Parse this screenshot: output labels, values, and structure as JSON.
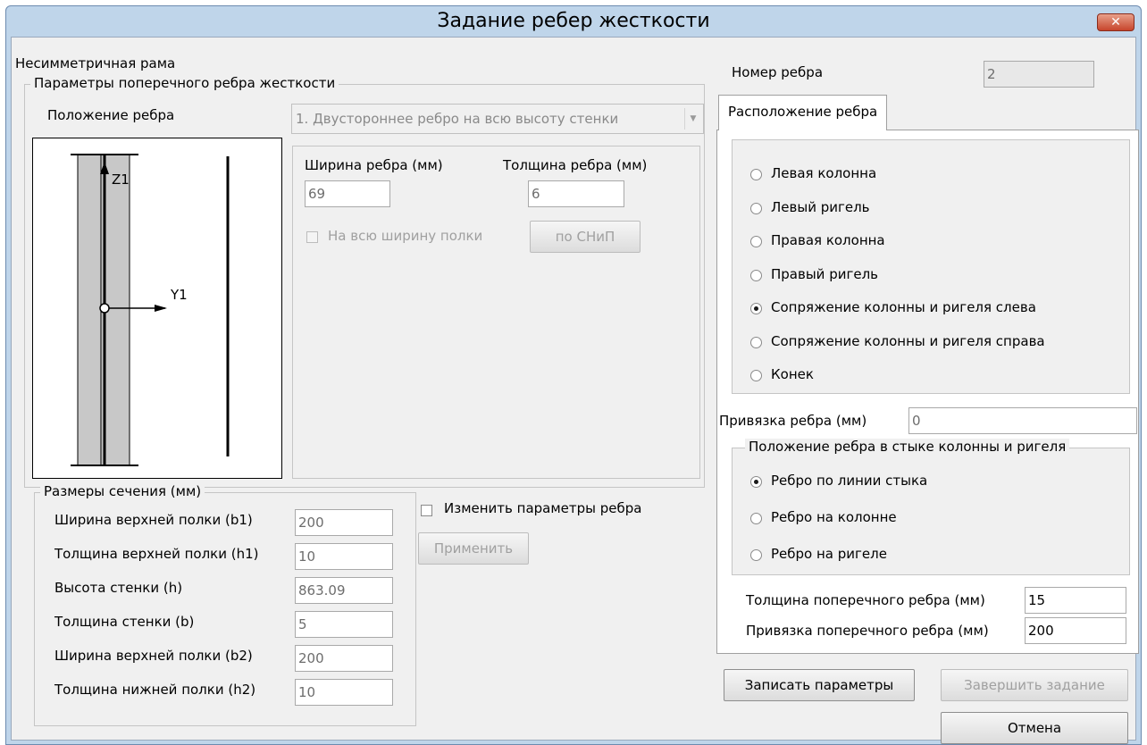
{
  "window": {
    "title": "Задание ребер жесткости",
    "close_label": "✕"
  },
  "frame_label": "Несимметричная рама",
  "rib_params": {
    "legend": "Параметры поперечного ребра жесткости",
    "position_label": "Положение ребра",
    "position_value": "1. Двустороннее ребро на всю высоту стенки",
    "width_label": "Ширина ребра (мм)",
    "width_value": "69",
    "thickness_label": "Толщина ребра (мм)",
    "thickness_value": "6",
    "full_width_label": "На всю ширину полки",
    "snip_button": "по СНиП"
  },
  "diagram": {
    "z_label": "Z1",
    "y_label": "Y1"
  },
  "section": {
    "legend": "Размеры сечения (мм)",
    "rows": [
      {
        "label": "Ширина верхней полки (b1)",
        "value": "200"
      },
      {
        "label": "Толщина верхней полки (h1)",
        "value": "10"
      },
      {
        "label": "Высота стенки (h)",
        "value": "863.09"
      },
      {
        "label": "Толщина стенки (b)",
        "value": "5"
      },
      {
        "label": "Ширина верхней полки (b2)",
        "value": "200"
      },
      {
        "label": "Толщина нижней полки (h2)",
        "value": "10"
      }
    ]
  },
  "change_params_label": "Изменить параметры ребра",
  "apply_button": "Применить",
  "rib_number": {
    "label": "Номер ребра",
    "value": "2"
  },
  "tab_label": "Расположение ребра",
  "location_options": [
    {
      "label": "Левая колонна",
      "selected": false
    },
    {
      "label": "Левый ригель",
      "selected": false
    },
    {
      "label": "Правая колонна",
      "selected": false
    },
    {
      "label": "Правый ригель",
      "selected": false
    },
    {
      "label": "Сопряжение колонны и ригеля слева",
      "selected": true
    },
    {
      "label": "Сопряжение колонны и ригеля справа",
      "selected": false
    },
    {
      "label": "Конек",
      "selected": false
    }
  ],
  "binding": {
    "label": "Привязка ребра (мм)",
    "value": "0"
  },
  "joint": {
    "legend": "Положение ребра в стыке колонны и ригеля",
    "options": [
      {
        "label": "Ребро по линии стыка",
        "selected": true
      },
      {
        "label": "Ребро на колонне",
        "selected": false
      },
      {
        "label": "Ребро на ригеле",
        "selected": false
      }
    ]
  },
  "cross_rib": {
    "thickness_label": "Толщина поперечного ребра (мм)",
    "thickness_value": "15",
    "binding_label": "Привязка поперечного ребра (мм)",
    "binding_value": "200"
  },
  "buttons": {
    "save": "Записать параметры",
    "finish": "Завершить задание",
    "cancel": "Отмена"
  }
}
